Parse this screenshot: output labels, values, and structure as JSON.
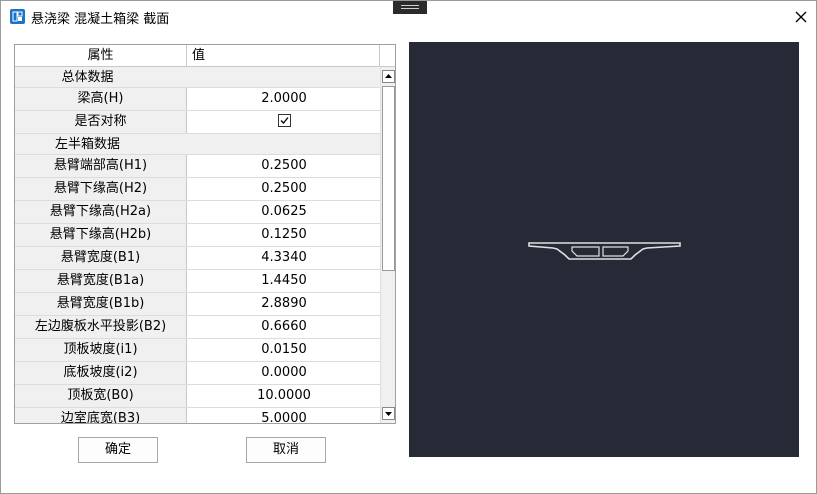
{
  "window": {
    "title": "悬浇梁 混凝土箱梁 截面"
  },
  "grid": {
    "headers": {
      "name": "属性",
      "value": "值"
    },
    "rows": [
      {
        "type": "category",
        "label": "总体数据"
      },
      {
        "type": "prop",
        "name": "梁高(H)",
        "value": "2.0000"
      },
      {
        "type": "prop",
        "name": "是否对称",
        "checkbox": true,
        "checked": true
      },
      {
        "type": "category",
        "label": "左半箱数据"
      },
      {
        "type": "prop",
        "name": "悬臂端部高(H1)",
        "value": "0.2500"
      },
      {
        "type": "prop",
        "name": "悬臂下缘高(H2)",
        "value": "0.2500"
      },
      {
        "type": "prop",
        "name": "悬臂下缘高(H2a)",
        "value": "0.0625"
      },
      {
        "type": "prop",
        "name": "悬臂下缘高(H2b)",
        "value": "0.1250"
      },
      {
        "type": "prop",
        "name": "悬臂宽度(B1)",
        "value": "4.3340"
      },
      {
        "type": "prop",
        "name": "悬臂宽度(B1a)",
        "value": "1.4450"
      },
      {
        "type": "prop",
        "name": "悬臂宽度(B1b)",
        "value": "2.8890"
      },
      {
        "type": "prop",
        "name": "左边腹板水平投影(B2)",
        "value": "0.6660"
      },
      {
        "type": "prop",
        "name": "顶板坡度(i1)",
        "value": "0.0150"
      },
      {
        "type": "prop",
        "name": "底板坡度(i2)",
        "value": "0.0000"
      },
      {
        "type": "prop",
        "name": "顶板宽(B0)",
        "value": "10.0000"
      },
      {
        "type": "prop",
        "name": "边室底宽(B3)",
        "value": "5.0000"
      }
    ]
  },
  "buttons": {
    "ok": "确定",
    "cancel": "取消"
  },
  "colors": {
    "preview_bg": "#252a36",
    "section_stroke": "#e0e0e0",
    "app_icon": "#1a73c8"
  },
  "icons": {
    "app": "app-icon",
    "close": "close-icon",
    "checkbox": "check-icon",
    "scroll_up": "arrow-up-icon",
    "scroll_down": "arrow-down-icon"
  }
}
